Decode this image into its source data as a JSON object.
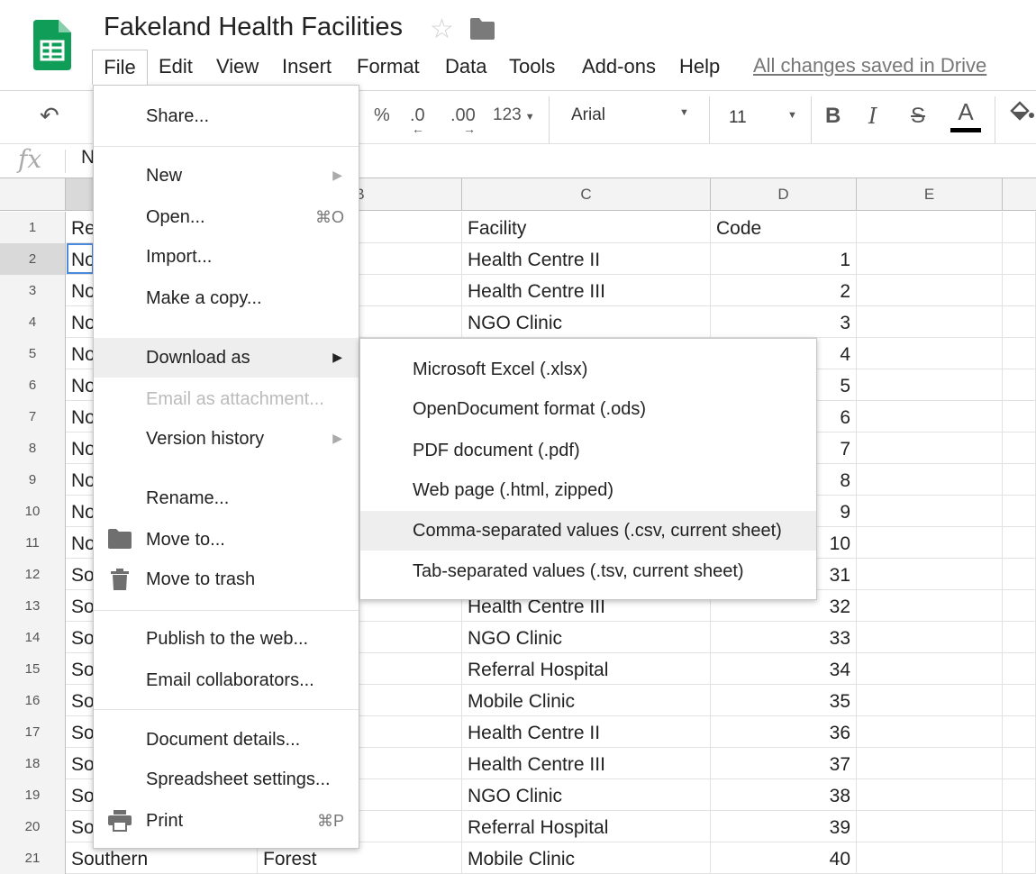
{
  "app": {
    "title": "Fakeland Health Facilities",
    "saved_status": "All changes saved in Drive",
    "accent_color": "#0f9d58"
  },
  "menubar": {
    "items": [
      "File",
      "Edit",
      "View",
      "Insert",
      "Format",
      "Data",
      "Tools",
      "Add-ons",
      "Help"
    ]
  },
  "toolbar": {
    "percent": "%",
    "decimal_less": ".0",
    "decimal_more": ".00",
    "number_format": "123",
    "font": "Arial",
    "font_size": "11",
    "bold": "B",
    "italic": "I",
    "strike": "S",
    "text_color": "A"
  },
  "formula_bar": {
    "fx": "fx",
    "value": "N"
  },
  "grid": {
    "columns": [
      "B",
      "C",
      "D",
      "E"
    ],
    "rows": [
      {
        "n": "1",
        "a": "Re",
        "b": "",
        "c": "Facility",
        "d": "Code"
      },
      {
        "n": "2",
        "a": "No",
        "b": "",
        "c": "Health Centre II",
        "d": "1"
      },
      {
        "n": "3",
        "a": "No",
        "b": "",
        "c": "Health Centre III",
        "d": "2"
      },
      {
        "n": "4",
        "a": "No",
        "b": "",
        "c": "NGO Clinic",
        "d": "3"
      },
      {
        "n": "5",
        "a": "No",
        "b": "",
        "c": "",
        "d": "4"
      },
      {
        "n": "6",
        "a": "No",
        "b": "",
        "c": "",
        "d": "5"
      },
      {
        "n": "7",
        "a": "No",
        "b": "",
        "c": "",
        "d": "6"
      },
      {
        "n": "8",
        "a": "No",
        "b": "",
        "c": "",
        "d": "7"
      },
      {
        "n": "9",
        "a": "No",
        "b": "",
        "c": "",
        "d": "8"
      },
      {
        "n": "10",
        "a": "No",
        "b": "",
        "c": "",
        "d": "9"
      },
      {
        "n": "11",
        "a": "No",
        "b": "",
        "c": "",
        "d": "10"
      },
      {
        "n": "12",
        "a": "So",
        "b": "",
        "c": "",
        "d": "31"
      },
      {
        "n": "13",
        "a": "So",
        "b": "",
        "c": "Health Centre III",
        "d": "32"
      },
      {
        "n": "14",
        "a": "So",
        "b": "",
        "c": "NGO Clinic",
        "d": "33"
      },
      {
        "n": "15",
        "a": "So",
        "b": "",
        "c": "Referral Hospital",
        "d": "34"
      },
      {
        "n": "16",
        "a": "So",
        "b": "",
        "c": "Mobile Clinic",
        "d": "35"
      },
      {
        "n": "17",
        "a": "So",
        "b": "",
        "c": "Health Centre II",
        "d": "36"
      },
      {
        "n": "18",
        "a": "So",
        "b": "",
        "c": "Health Centre III",
        "d": "37"
      },
      {
        "n": "19",
        "a": "So",
        "b": "",
        "c": "NGO Clinic",
        "d": "38"
      },
      {
        "n": "20",
        "a": "So",
        "b": "",
        "c": "Referral Hospital",
        "d": "39"
      },
      {
        "n": "21",
        "a": "Southern",
        "b": "Forest",
        "c": "Mobile Clinic",
        "d": "40"
      }
    ]
  },
  "file_menu": {
    "share": "Share...",
    "new": "New",
    "open": "Open...",
    "open_shortcut": "⌘O",
    "import": "Import...",
    "make_copy": "Make a copy...",
    "download_as": "Download as",
    "email_attachment": "Email as attachment...",
    "version_history": "Version history",
    "rename": "Rename...",
    "move_to": "Move to...",
    "move_to_trash": "Move to trash",
    "publish": "Publish to the web...",
    "email_collaborators": "Email collaborators...",
    "document_details": "Document details...",
    "spreadsheet_settings": "Spreadsheet settings...",
    "print": "Print",
    "print_shortcut": "⌘P"
  },
  "download_submenu": {
    "items": [
      "Microsoft Excel (.xlsx)",
      "OpenDocument format (.ods)",
      "PDF document (.pdf)",
      "Web page (.html, zipped)",
      "Comma-separated values (.csv, current sheet)",
      "Tab-separated values (.tsv, current sheet)"
    ]
  }
}
